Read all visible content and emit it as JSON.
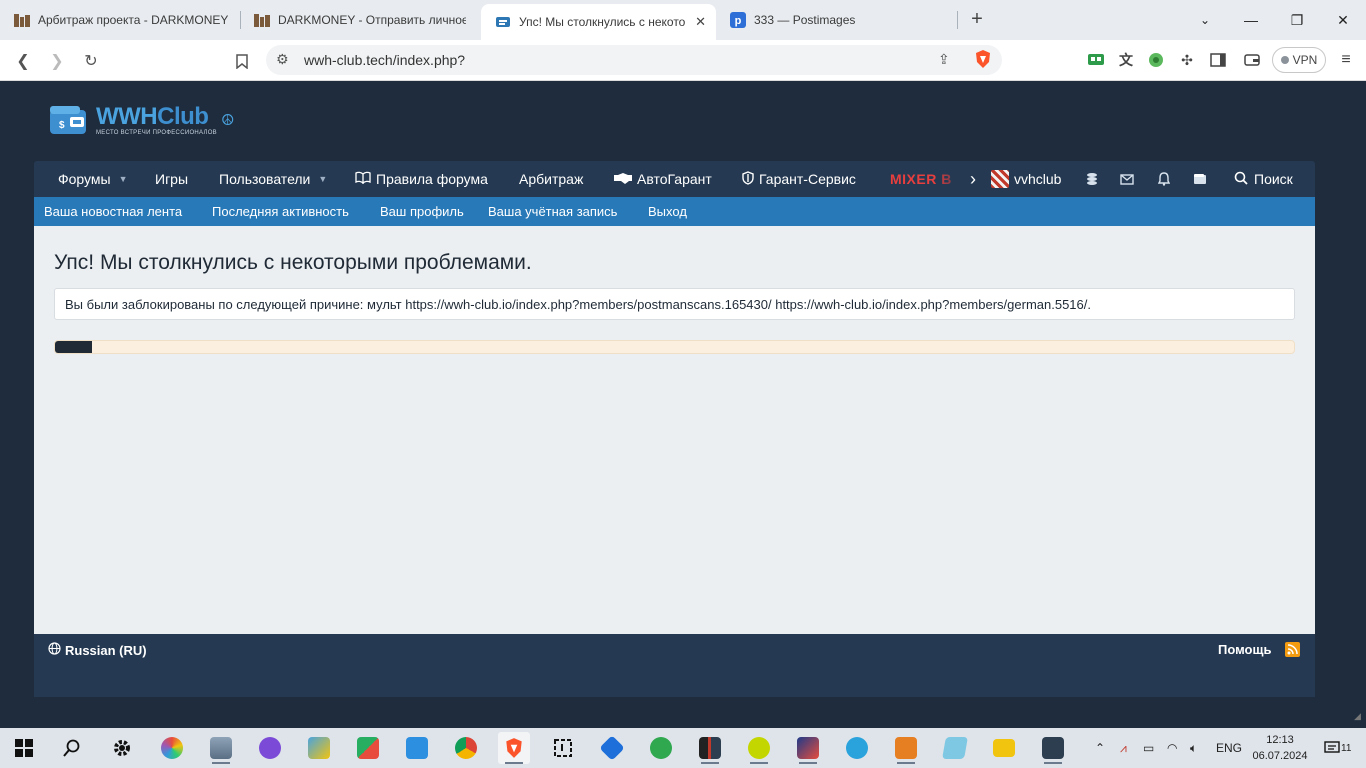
{
  "browser": {
    "tabs": [
      {
        "title": "Арбитраж проекта - DARKMONEY",
        "active": false
      },
      {
        "title": "DARKMONEY - Отправить личное с",
        "active": false
      },
      {
        "title": "Упс! Мы столкнулись с некото",
        "active": true
      },
      {
        "title": "333 — Postimages",
        "active": false
      }
    ],
    "url": "wwh-club.tech/index.php?",
    "vpn_label": "VPN",
    "new_tab": "+",
    "win_min": "—",
    "win_max": "❐",
    "win_close": "✕"
  },
  "site": {
    "logo_title": "WWH",
    "logo_title_club": "Club",
    "logo_subtitle": "МЕСТО ВСТРЕЧИ ПРОФЕССИОНАЛОВ"
  },
  "nav": {
    "forums": "Форумы",
    "games": "Игры",
    "users": "Пользователи",
    "rules": "Правила форума",
    "arbitrage": "Арбитраж",
    "autogarant": "АвтоГарант",
    "garant_service": "Гарант-Сервис",
    "mixer": "MIXER B",
    "username": "vvhclub",
    "search": "Поиск"
  },
  "subnav": {
    "news_feed": "Ваша новостная лента",
    "recent_activity": "Последняя активность",
    "your_profile": "Ваш профиль",
    "your_account": "Ваша учётная запись",
    "logout": "Выход"
  },
  "main": {
    "title": "Упс! Мы столкнулись с некоторыми проблемами.",
    "message": "Вы были заблокированы по следующей причине: мульт https://wwh-club.io/index.php?members/postmanscans.165430/ https://wwh-club.io/index.php?members/german.5516/.",
    "progress_fraction": 0.002
  },
  "footer": {
    "language": "Russian (RU)",
    "help": "Помощь"
  },
  "taskbar": {
    "language": "ENG",
    "time": "12:13",
    "date": "06.07.2024",
    "notifications_count": "11"
  },
  "colors": {
    "page_bg": "#1e2c3d",
    "navbar": "#253a52",
    "subnav": "#2879b8",
    "mixer": "#e83e3e",
    "progress_bg": "#fbf0e0"
  }
}
